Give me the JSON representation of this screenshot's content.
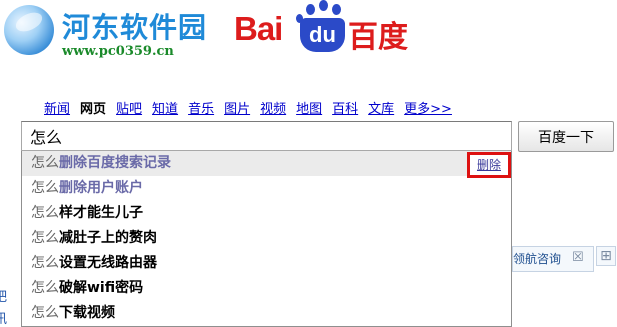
{
  "watermark": {
    "title": "河东软件园",
    "url": "www.pc0359.cn"
  },
  "logo": {
    "bai": "Bai",
    "du": "du",
    "cn": "百度"
  },
  "nav": {
    "items": [
      "新闻",
      "网页",
      "贴吧",
      "知道",
      "音乐",
      "图片",
      "视频",
      "地图",
      "百科",
      "文库",
      "更多>>"
    ],
    "active_index": 1
  },
  "search": {
    "value": "怎么",
    "button_label": "百度一下"
  },
  "suggestions": [
    {
      "prefix": "怎么",
      "rest": "删除百度搜索记录",
      "history": true
    },
    {
      "prefix": "怎么",
      "rest": "删除用户账户",
      "history": true
    },
    {
      "prefix": "怎么",
      "rest": "样才能生儿子",
      "history": false
    },
    {
      "prefix": "怎么",
      "rest": "减肚子上的赘肉",
      "history": false
    },
    {
      "prefix": "怎么",
      "rest": "设置无线路由器",
      "history": false
    },
    {
      "prefix": "怎么",
      "rest": "破解wifi密码",
      "history": false
    },
    {
      "prefix": "怎么",
      "rest": "下载视频",
      "history": false
    }
  ],
  "delete_label": "删除",
  "side_panel": {
    "consult_text": "领航咨询",
    "close": "☒",
    "plus": "⊞"
  },
  "left_edge": [
    "吧",
    "讯"
  ],
  "colors": {
    "baidu_red": "#dd1c1c",
    "baidu_blue": "#2b4ac8",
    "highlight_box": "#dd1111",
    "link": "#0000cc"
  }
}
